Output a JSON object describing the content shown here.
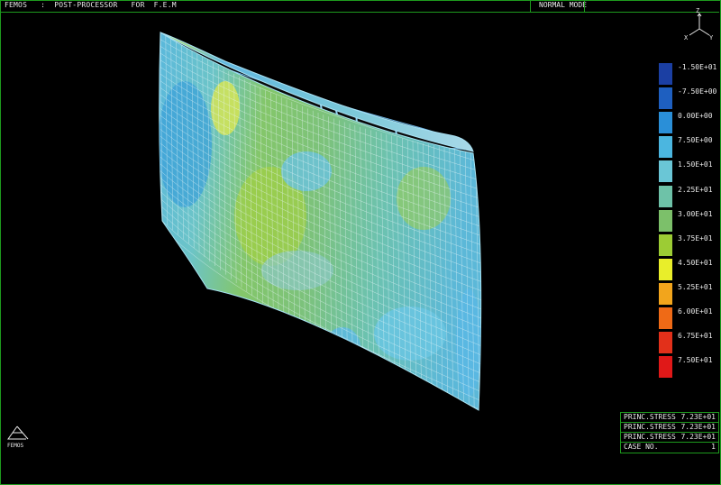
{
  "header": {
    "app_name": "FEMOS",
    "separator": ":",
    "title": "POST-PROCESSOR",
    "for_label": "FOR",
    "subject": "F.E.M",
    "mode": "NORMAL MODE"
  },
  "axes": {
    "z": "Z",
    "x": "X",
    "y": "Y"
  },
  "legend": {
    "items": [
      {
        "label": "-1.50E+01",
        "color": "#1b3fa3"
      },
      {
        "label": "-7.50E+00",
        "color": "#1e5fc0"
      },
      {
        "label": "0.00E+00",
        "color": "#2a8fd8"
      },
      {
        "label": "7.50E+00",
        "color": "#4bb6e0"
      },
      {
        "label": "1.50E+01",
        "color": "#6ac6d6"
      },
      {
        "label": "2.25E+01",
        "color": "#6ec2a8"
      },
      {
        "label": "3.00E+01",
        "color": "#7cc06a"
      },
      {
        "label": "3.75E+01",
        "color": "#9ccc34"
      },
      {
        "label": "4.50E+01",
        "color": "#e9ee2a"
      },
      {
        "label": "5.25E+01",
        "color": "#f2a51c"
      },
      {
        "label": "6.00E+01",
        "color": "#ef6a16"
      },
      {
        "label": "6.75E+01",
        "color": "#e2301a"
      },
      {
        "label": "7.50E+01",
        "color": "#e01818"
      }
    ]
  },
  "info_box": {
    "rows": [
      {
        "key": "PRINC.STRESS",
        "value": "7.23E+01"
      },
      {
        "key": "PRINC.STRESS",
        "value": "7.23E+01"
      },
      {
        "key": "PRINC.STRESS",
        "value": "7.23E+01"
      },
      {
        "key": "CASE NO.",
        "value": "1"
      }
    ]
  },
  "logo": {
    "text": "FEMOS"
  }
}
